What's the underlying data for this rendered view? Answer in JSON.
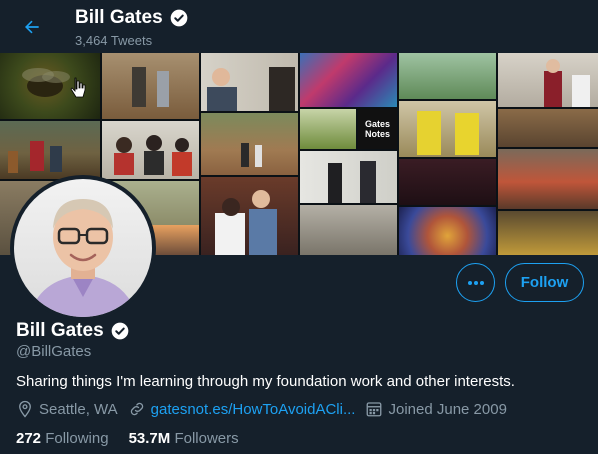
{
  "header": {
    "name": "Bill Gates",
    "tweet_count": "3,464 Tweets"
  },
  "profile": {
    "name": "Bill Gates",
    "handle": "@BillGates",
    "bio": "Sharing things I'm learning through my foundation work and other interests.",
    "location": "Seattle, WA",
    "website": "gatesnot.es/HowToAvoidACli...",
    "joined": "Joined June 2009",
    "following_count": "272",
    "following_label": "Following",
    "followers_count": "53.7M",
    "followers_label": "Followers"
  },
  "banner": {
    "gates_notes_label_line1": "Gates",
    "gates_notes_label_line2": "Notes"
  },
  "actions": {
    "follow_label": "Follow",
    "more_icon": "more-dots-icon"
  },
  "colors": {
    "background": "#15202b",
    "accent": "#1da1f2",
    "secondary_text": "#8899a6"
  }
}
